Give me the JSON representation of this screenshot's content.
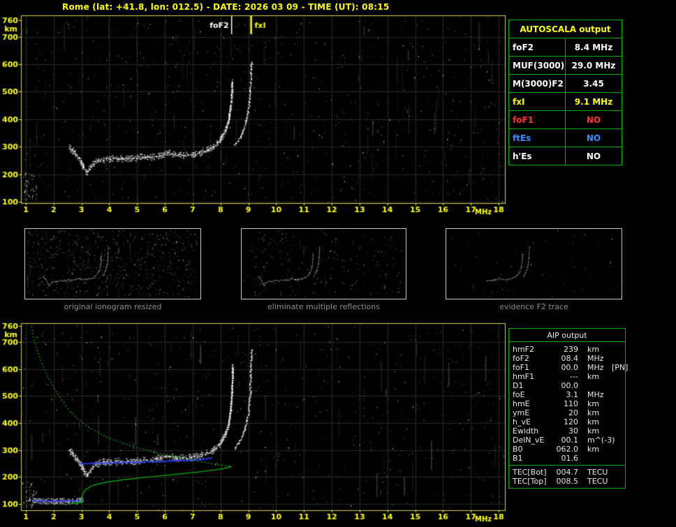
{
  "header": {
    "title": "Rome (lat: +41.8, lon: 012.5) - DATE: 2026 03 09 - TIME (UT): 08:15"
  },
  "colors": {
    "accent_yellow": "#ffff00",
    "plot_border": "#d8d838",
    "table_green": "#00b000",
    "caption_gray": "#8f8f8f",
    "fit_blue": "#2b3cff",
    "profile_green": "#00c000",
    "alarm_red": "#ff3030",
    "info_blue": "#3b8eff",
    "trace_white": "#ffffff"
  },
  "autoscala_table": {
    "title": "AUTOSCALA output",
    "rows": [
      {
        "label": "foF2",
        "value": "8.4 MHz",
        "color": "#ffffff"
      },
      {
        "label": "MUF(3000)F2",
        "value": "29.0 MHz",
        "color": "#ffffff"
      },
      {
        "label": "M(3000)F2",
        "value": "3.45",
        "color": "#ffffff"
      },
      {
        "label": "fxI",
        "value": "9.1 MHz",
        "color": "#ffff00"
      },
      {
        "label": "foF1",
        "value": "NO",
        "color": "#ff3030"
      },
      {
        "label": "ftEs",
        "value": "NO",
        "color": "#3b8eff"
      },
      {
        "label": "h'Es",
        "value": "NO",
        "color": "#ffffff"
      }
    ]
  },
  "thumbnails": [
    {
      "caption": "original ionogram resized",
      "noise_dots": 650,
      "streaks": 18,
      "min_frequency": 0
    },
    {
      "caption": "eliminate multiple reflections",
      "noise_dots": 230,
      "streaks": 8,
      "min_frequency": 0
    },
    {
      "caption": "evidence F2 trace",
      "noise_dots": 55,
      "streaks": 2,
      "min_frequency": 4.6
    }
  ],
  "aip_table": {
    "title": "AIP output",
    "rows": [
      {
        "label": "hmF2",
        "value": "239",
        "unit": "km",
        "note": ""
      },
      {
        "label": "foF2",
        "value": "08.4",
        "unit": "MHz",
        "note": ""
      },
      {
        "label": "foF1",
        "value": "00.0",
        "unit": "MHz",
        "note": "[PN]"
      },
      {
        "label": "hmF1",
        "value": "---",
        "unit": "km",
        "note": ""
      },
      {
        "label": "D1",
        "value": "00.0",
        "unit": "",
        "note": ""
      },
      {
        "label": "foE",
        "value": "3.1",
        "unit": "MHz",
        "note": ""
      },
      {
        "label": "hmE",
        "value": "110",
        "unit": "km",
        "note": ""
      },
      {
        "label": "ymE",
        "value": "20",
        "unit": "km",
        "note": ""
      },
      {
        "label": "h_vE",
        "value": "120",
        "unit": "km",
        "note": ""
      },
      {
        "label": "Ewidth",
        "value": "30",
        "unit": "km",
        "note": ""
      },
      {
        "label": "DelN_vE",
        "value": "00.1",
        "unit": "m^(-3)",
        "note": ""
      },
      {
        "label": "B0",
        "value": "062.0",
        "unit": "km",
        "note": ""
      },
      {
        "label": "B1",
        "value": "01.6",
        "unit": "",
        "note": ""
      }
    ],
    "tec_rows": [
      {
        "label": "TEC[Bot]",
        "value": "004.7",
        "unit": "TECU",
        "note": ""
      },
      {
        "label": "TEC[Top]",
        "value": "008.5",
        "unit": "TECU",
        "note": ""
      }
    ]
  },
  "chart_data": [
    {
      "id": "main_ionogram",
      "type": "scatter",
      "title": "recorded ionogram",
      "xlabel": "MHz",
      "ylabel": "km",
      "xlim": [
        1,
        18
      ],
      "ylim": [
        100,
        760
      ],
      "xticks": [
        1,
        2,
        3,
        4,
        5,
        6,
        7,
        8,
        9,
        10,
        11,
        12,
        13,
        14,
        15,
        16,
        17,
        18
      ],
      "yticks": [
        100,
        200,
        300,
        400,
        500,
        600,
        700,
        760
      ],
      "grid": true,
      "markers": [
        {
          "label": "foF2",
          "x": 8.4,
          "color": "#ffffff",
          "label_side": "left"
        },
        {
          "label": "fxI",
          "x": 9.1,
          "color": "#ffff00",
          "label_side": "right"
        }
      ],
      "noise": {
        "dots": 850,
        "streaks": 65,
        "corner": 60
      },
      "series": [
        {
          "name": "F2 ordinary trace",
          "color": "#ffffff",
          "render": "trace",
          "size": 2,
          "jitter": 3,
          "thick": true,
          "points": [
            [
              2.55,
              300
            ],
            [
              2.75,
              278
            ],
            [
              2.95,
              250
            ],
            [
              3.08,
              224
            ],
            [
              3.18,
              210
            ],
            [
              3.32,
              230
            ],
            [
              3.5,
              250
            ],
            [
              3.8,
              256
            ],
            [
              4.2,
              259
            ],
            [
              4.8,
              261
            ],
            [
              5.4,
              264
            ],
            [
              5.9,
              272
            ],
            [
              6.1,
              281
            ],
            [
              6.35,
              272
            ],
            [
              6.8,
              273
            ],
            [
              7.1,
              277
            ],
            [
              7.4,
              286
            ],
            [
              7.7,
              300
            ],
            [
              7.95,
              324
            ],
            [
              8.15,
              358
            ],
            [
              8.28,
              400
            ],
            [
              8.35,
              450
            ],
            [
              8.39,
              505
            ],
            [
              8.41,
              545
            ]
          ]
        },
        {
          "name": "F2 extraordinary trace",
          "color": "#ffffff",
          "render": "trace",
          "size": 2,
          "jitter": 2,
          "points": [
            [
              8.5,
              308
            ],
            [
              8.66,
              330
            ],
            [
              8.8,
              360
            ],
            [
              8.92,
              400
            ],
            [
              9.0,
              450
            ],
            [
              9.05,
              505
            ],
            [
              9.08,
              560
            ],
            [
              9.1,
              615
            ]
          ]
        },
        {
          "name": "second reflection",
          "color": "#8f8f8f",
          "render": "sparse",
          "points": [
            [
              7.4,
              575
            ],
            [
              7.9,
              615
            ],
            [
              8.35,
              650
            ],
            [
              8.9,
              672
            ],
            [
              9.5,
              688
            ],
            [
              10.3,
              702
            ]
          ]
        }
      ]
    },
    {
      "id": "profile_ionogram",
      "type": "scatter",
      "title": "scaled ionogram with electron density profile",
      "xlabel": "MHz",
      "ylabel": "km",
      "xlim": [
        1,
        18
      ],
      "ylim": [
        100,
        760
      ],
      "xticks": [
        1,
        2,
        3,
        4,
        5,
        6,
        7,
        8,
        9,
        10,
        11,
        12,
        13,
        14,
        15,
        16,
        17,
        18
      ],
      "yticks": [
        100,
        200,
        300,
        400,
        500,
        600,
        700,
        760
      ],
      "grid": true,
      "markers": [],
      "noise": {
        "dots": 800,
        "streaks": 55,
        "corner": 50
      },
      "series": [
        {
          "name": "F2 ordinary trace",
          "color": "#ffffff",
          "render": "trace",
          "size": 2,
          "jitter": 3,
          "thick": true,
          "points": [
            [
              2.55,
              300
            ],
            [
              2.75,
              278
            ],
            [
              2.95,
              250
            ],
            [
              3.08,
              224
            ],
            [
              3.18,
              210
            ],
            [
              3.32,
              230
            ],
            [
              3.5,
              250
            ],
            [
              3.8,
              256
            ],
            [
              4.2,
              259
            ],
            [
              4.8,
              261
            ],
            [
              5.4,
              264
            ],
            [
              5.9,
              272
            ],
            [
              6.1,
              281
            ],
            [
              6.35,
              272
            ],
            [
              6.8,
              273
            ],
            [
              7.1,
              277
            ],
            [
              7.4,
              286
            ],
            [
              7.7,
              300
            ],
            [
              7.95,
              324
            ],
            [
              8.15,
              358
            ],
            [
              8.28,
              400
            ],
            [
              8.35,
              450
            ],
            [
              8.39,
              510
            ],
            [
              8.41,
              560
            ],
            [
              8.42,
              620
            ]
          ]
        },
        {
          "name": "F2 extraordinary trace",
          "color": "#ffffff",
          "render": "trace",
          "size": 2,
          "jitter": 2,
          "points": [
            [
              8.5,
              308
            ],
            [
              8.66,
              330
            ],
            [
              8.8,
              360
            ],
            [
              8.92,
              400
            ],
            [
              9.0,
              450
            ],
            [
              9.05,
              510
            ],
            [
              9.08,
              600
            ],
            [
              9.1,
              680
            ]
          ]
        },
        {
          "name": "E trace",
          "color": "#ffffff",
          "render": "trace",
          "size": 2,
          "jitter": 2,
          "thick": true,
          "points": [
            [
              1.1,
              116
            ],
            [
              1.6,
              113
            ],
            [
              2.2,
              112
            ],
            [
              2.7,
              113
            ],
            [
              3.05,
              118
            ]
          ]
        },
        {
          "name": "second reflection",
          "color": "#8f8f8f",
          "render": "sparse",
          "points": [
            [
              7.4,
              575
            ],
            [
              7.9,
              615
            ],
            [
              8.35,
              650
            ],
            [
              8.9,
              672
            ],
            [
              9.5,
              688
            ],
            [
              10.3,
              702
            ]
          ]
        },
        {
          "name": "Autoscala fitted F2 trace",
          "color": "#2b3cff",
          "render": "dots",
          "points": [
            [
              2.9,
              252
            ],
            [
              3.6,
              254
            ],
            [
              4.4,
              256
            ],
            [
              5.2,
              258
            ],
            [
              6.0,
              261
            ],
            [
              6.8,
              264
            ],
            [
              7.4,
              268
            ],
            [
              7.7,
              273
            ]
          ]
        },
        {
          "name": "Autoscala fitted E trace",
          "color": "#2b3cff",
          "render": "dots",
          "points": [
            [
              1.25,
              114
            ],
            [
              1.9,
              113
            ],
            [
              2.6,
              113
            ],
            [
              3.0,
              115
            ]
          ]
        },
        {
          "name": "electron density profile topside",
          "color": "#00c000",
          "render": "line",
          "style": "dotted",
          "points": [
            [
              1.2,
              760
            ],
            [
              1.3,
              705
            ],
            [
              1.5,
              640
            ],
            [
              1.75,
              580
            ],
            [
              2.1,
              515
            ],
            [
              2.6,
              440
            ],
            [
              3.2,
              388
            ],
            [
              3.9,
              348
            ],
            [
              4.8,
              314
            ],
            [
              5.8,
              287
            ],
            [
              6.8,
              265
            ],
            [
              7.6,
              251
            ],
            [
              8.1,
              243
            ],
            [
              8.4,
              239
            ]
          ]
        },
        {
          "name": "electron density profile bottomside",
          "color": "#00c000",
          "render": "line",
          "style": "solid",
          "points": [
            [
              8.4,
              239
            ],
            [
              8.1,
              231
            ],
            [
              7.4,
              221
            ],
            [
              6.5,
              211
            ],
            [
              5.5,
              201
            ],
            [
              4.6,
              191
            ],
            [
              3.9,
              181
            ],
            [
              3.4,
              169
            ],
            [
              3.15,
              154
            ],
            [
              3.05,
              137
            ],
            [
              3.0,
              123
            ],
            [
              3.07,
              112
            ],
            [
              2.9,
              105
            ],
            [
              2.5,
              100
            ]
          ]
        }
      ]
    }
  ]
}
